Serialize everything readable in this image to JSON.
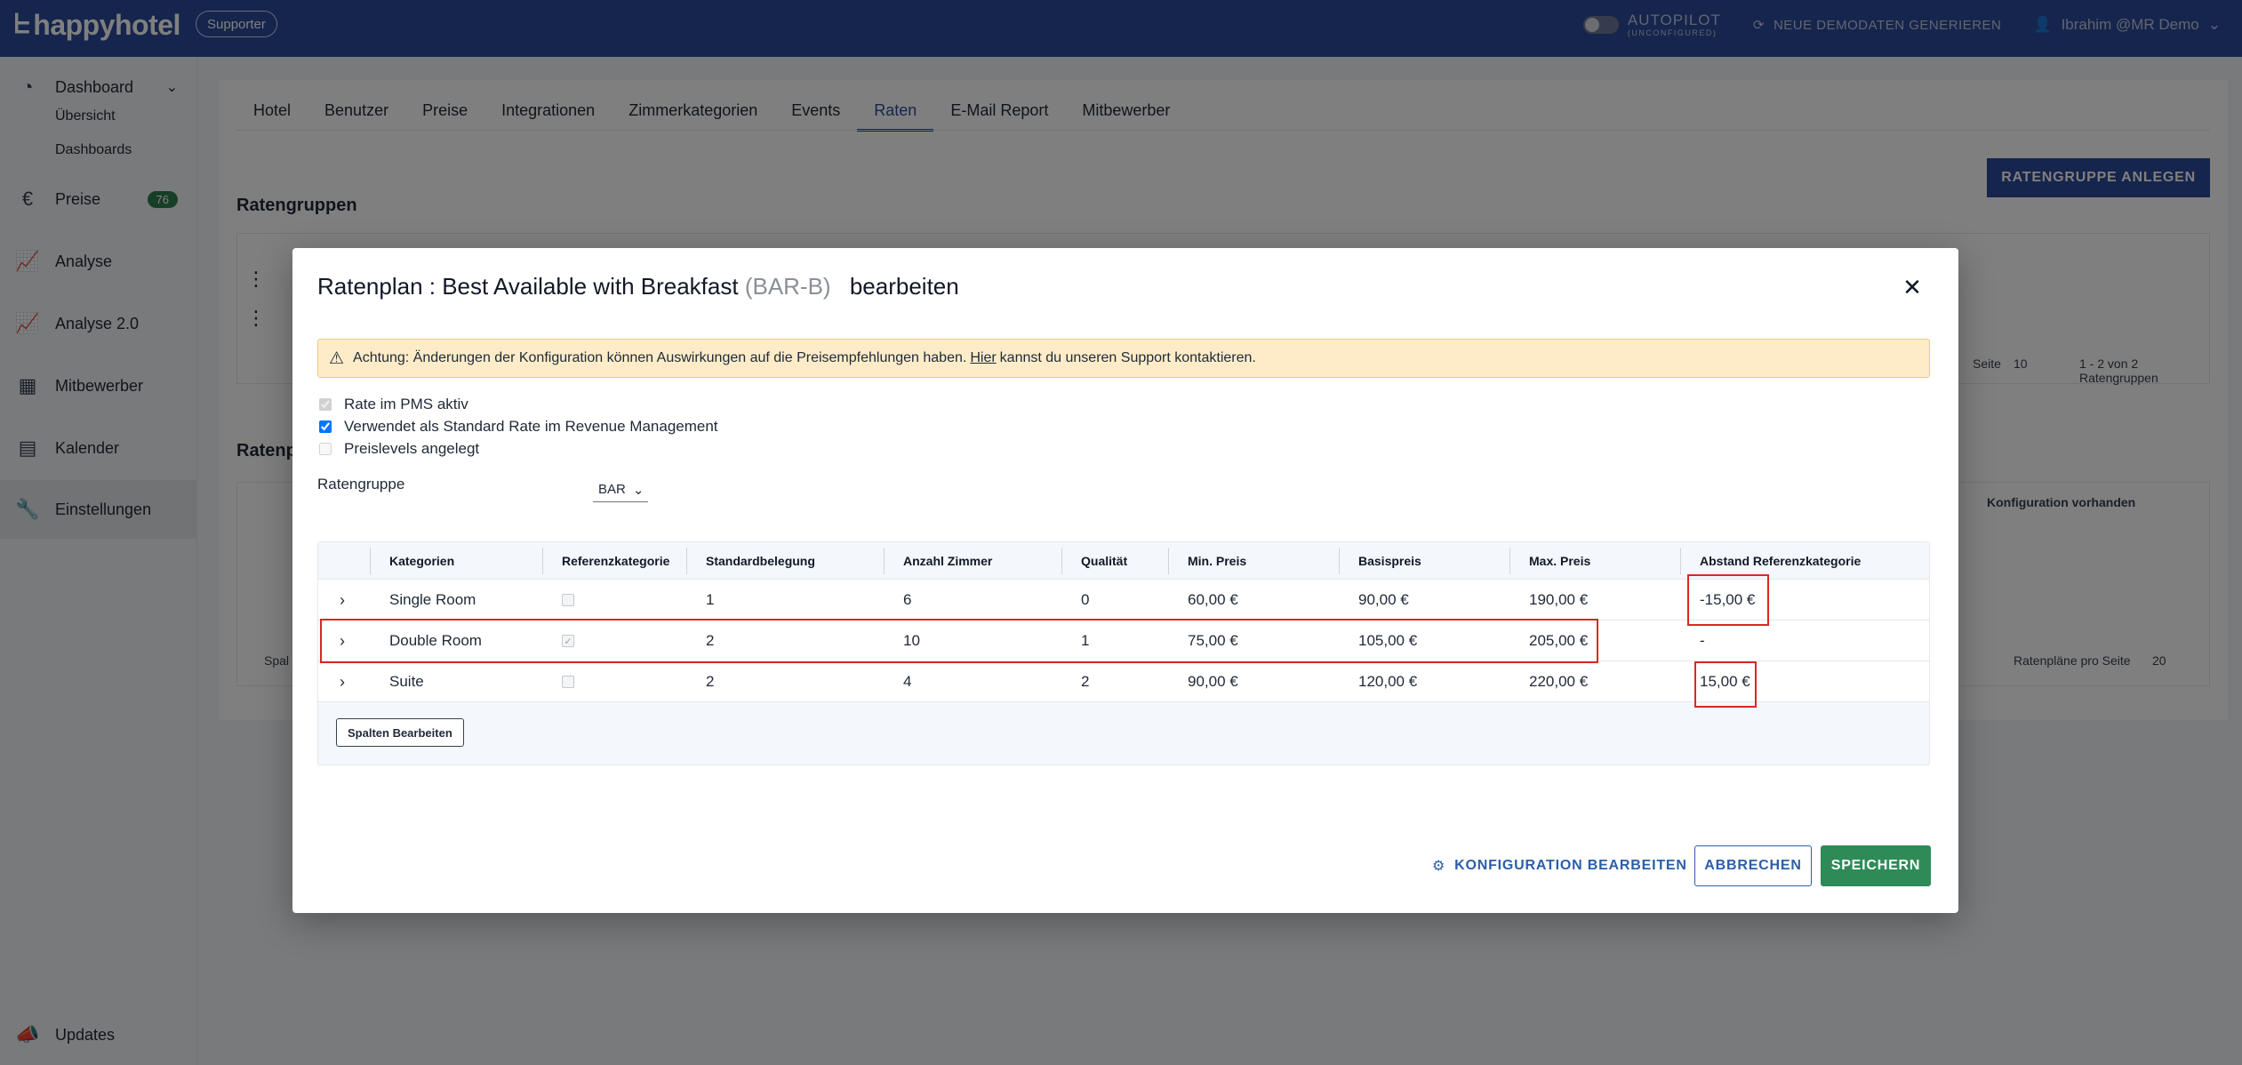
{
  "brand": {
    "logo": "happyhotel",
    "badge": "Supporter"
  },
  "topbar": {
    "autopilot_label": "AUTOPILOT",
    "autopilot_sub": "(UNCONFIGURED)",
    "demo_label": "NEUE DEMODATEN GENERIEREN",
    "user_label": "Ibrahim @MR Demo"
  },
  "sidebar": {
    "dashboard": "Dashboard",
    "sub_uebersicht": "Übersicht",
    "sub_dashboards": "Dashboards",
    "preise": "Preise",
    "preise_count": "76",
    "analyse": "Analyse",
    "analyse2": "Analyse 2.0",
    "mitbewerber": "Mitbewerber",
    "kalender": "Kalender",
    "einstellungen": "Einstellungen",
    "updates": "Updates"
  },
  "tabs": [
    "Hotel",
    "Benutzer",
    "Preise",
    "Integrationen",
    "Zimmerkategorien",
    "Events",
    "Raten",
    "E-Mail Report",
    "Mitbewerber"
  ],
  "background": {
    "create_group_btn": "RATENGRUPPE ANLEGEN",
    "section_ratengruppen": "Ratengruppen",
    "section_ratenplaene": "Ratenp",
    "seite_label": "Seite",
    "per_page_groups": "10",
    "groups_count": "1 - 2 von 2 Ratengruppen",
    "konfig_col": "Konfiguration vorhanden",
    "plans_per_page_label": "Ratenpläne pro Seite",
    "plans_per_page": "20",
    "spal_btn": "Spal"
  },
  "modal": {
    "title_prefix": "Ratenplan : Best Available with Breakfast",
    "title_code": "(BAR-B)",
    "title_suffix": "bearbeiten",
    "alert_before": "Achtung: Änderungen der Konfiguration können Auswirkungen auf die Preisempfehlungen haben.",
    "alert_link": "Hier",
    "alert_after": "kannst du unseren Support kontaktieren.",
    "check_pms": "Rate im PMS aktiv",
    "check_standard": "Verwendet als Standard Rate im Revenue Management",
    "check_levels": "Preislevels angelegt",
    "ratengruppe_label": "Ratengruppe",
    "ratengruppe_value": "BAR",
    "columns": [
      "Kategorien",
      "Referenzkategorie",
      "Standardbelegung",
      "Anzahl Zimmer",
      "Qualität",
      "Min. Preis",
      "Basispreis",
      "Max. Preis",
      "Abstand Referenzkategorie"
    ],
    "rows": [
      {
        "kategorie": "Single Room",
        "ref": false,
        "standard": "1",
        "zimmer": "6",
        "qualitaet": "0",
        "min": "60,00 €",
        "basis": "90,00 €",
        "max": "190,00 €",
        "abstand": "-15,00 €"
      },
      {
        "kategorie": "Double Room",
        "ref": true,
        "standard": "2",
        "zimmer": "10",
        "qualitaet": "1",
        "min": "75,00 €",
        "basis": "105,00 €",
        "max": "205,00 €",
        "abstand": "-"
      },
      {
        "kategorie": "Suite",
        "ref": false,
        "standard": "2",
        "zimmer": "4",
        "qualitaet": "2",
        "min": "90,00 €",
        "basis": "120,00 €",
        "max": "220,00 €",
        "abstand": "15,00 €"
      }
    ],
    "edit_columns_btn": "Spalten Bearbeiten",
    "konfig_btn": "KONFIGURATION BEARBEITEN",
    "cancel_btn": "ABBRECHEN",
    "save_btn": "SPEICHERN"
  },
  "colors": {
    "brand_blue": "#2c4a9a",
    "save_green": "#2e8b57",
    "highlight_red": "#dc2626",
    "alert_bg": "#feecc8"
  }
}
